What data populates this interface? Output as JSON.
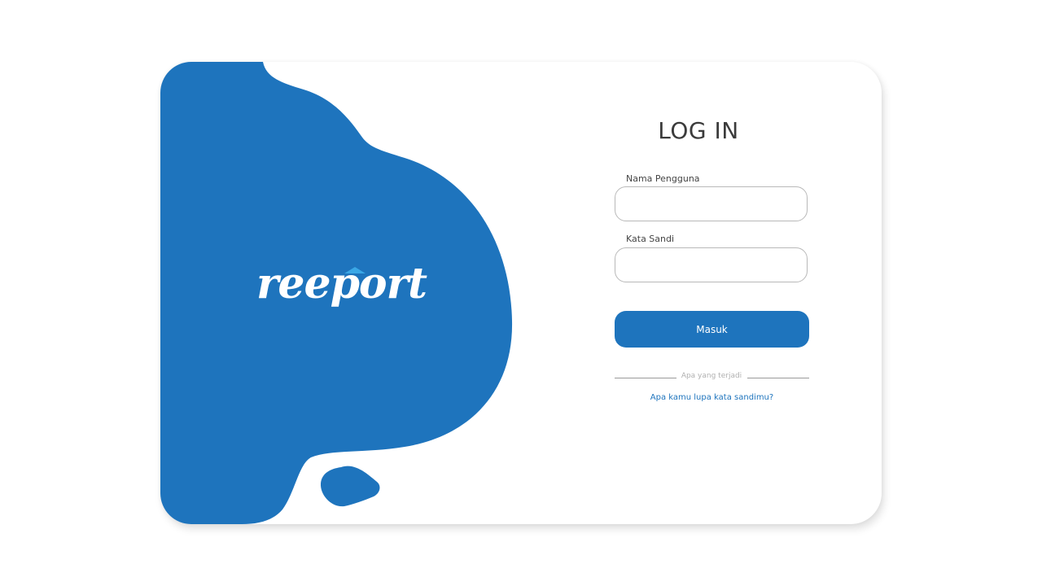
{
  "brand": {
    "logo_text": "reeport",
    "primary_color": "#1e74bd",
    "accent_color": "#3aa7e6"
  },
  "login": {
    "title": "LOG IN",
    "username_label": "Nama Pengguna",
    "username_value": "",
    "password_label": "Kata Sandi",
    "password_value": "",
    "submit_label": "Masuk",
    "divider_text": "Apa yang terjadi",
    "forgot_link": "Apa kamu lupa kata sandimu?"
  }
}
